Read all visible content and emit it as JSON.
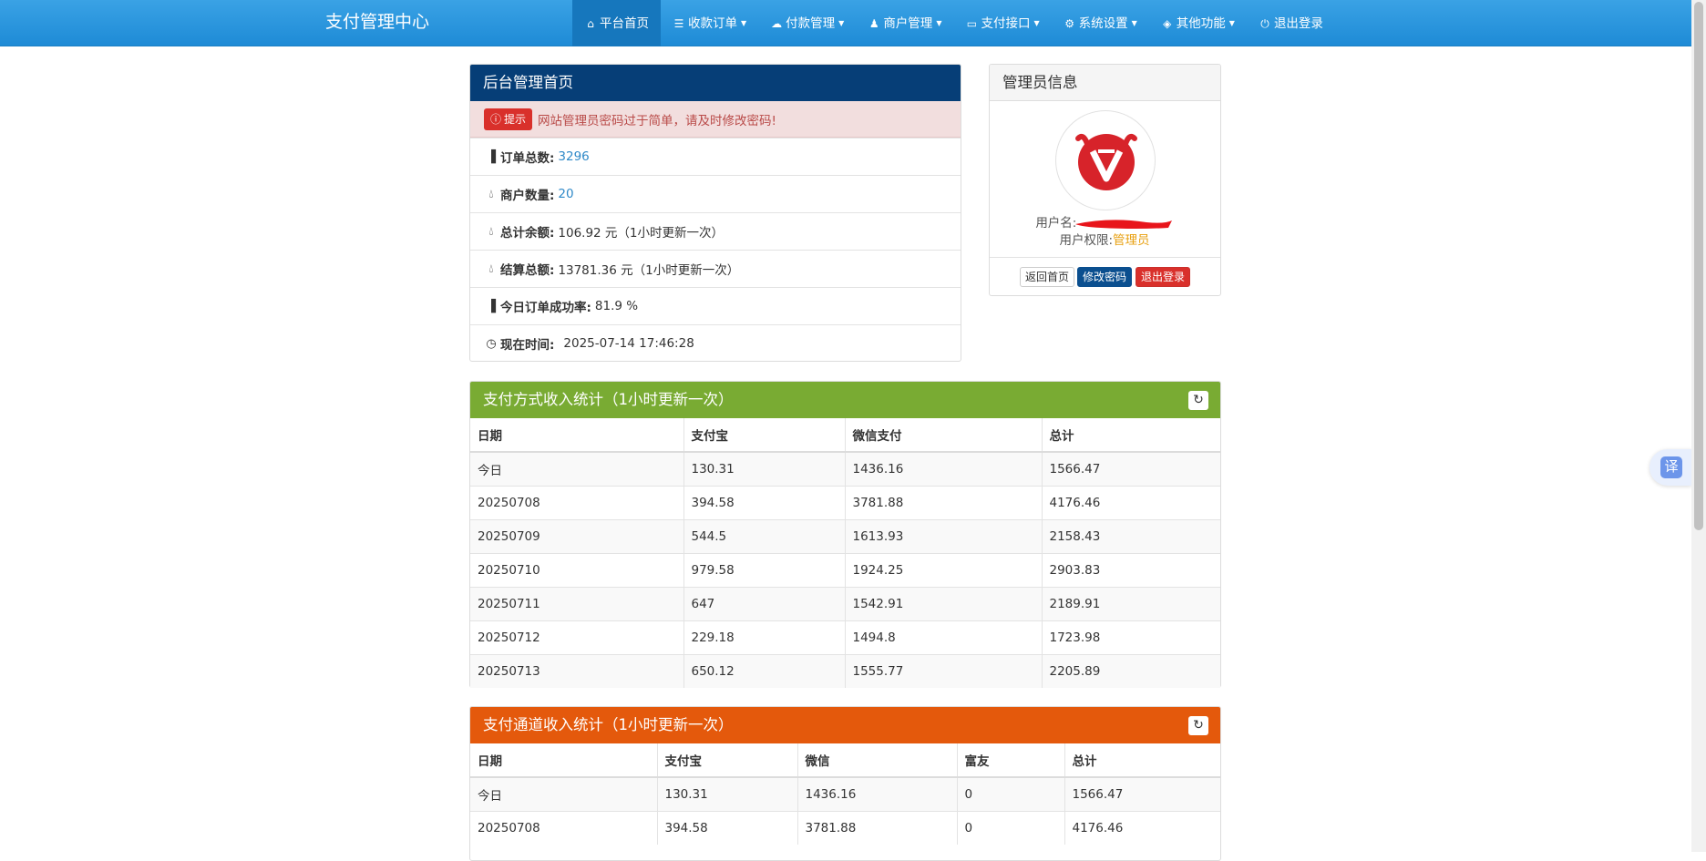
{
  "brand": "支付管理中心",
  "nav": [
    {
      "icon": "home-icon",
      "glyph": "⌂",
      "label": "平台首页",
      "caret": false,
      "active": true
    },
    {
      "icon": "list-icon",
      "glyph": "☰",
      "label": "收款订单",
      "caret": true
    },
    {
      "icon": "cloud-icon",
      "glyph": "☁",
      "label": "付款管理",
      "caret": true
    },
    {
      "icon": "user-icon",
      "glyph": "♟",
      "label": "商户管理",
      "caret": true
    },
    {
      "icon": "card-icon",
      "glyph": "▭",
      "label": "支付接口",
      "caret": true
    },
    {
      "icon": "gear-icon",
      "glyph": "⚙",
      "label": "系统设置",
      "caret": true
    },
    {
      "icon": "cube-icon",
      "glyph": "◈",
      "label": "其他功能",
      "caret": true
    },
    {
      "icon": "power-icon",
      "glyph": "⏻",
      "label": "退出登录",
      "caret": false
    }
  ],
  "home_panel": {
    "title": "后台管理首页",
    "alert_badge": "提示",
    "alert_text": "网站管理员密码过于简单，请及时修改密码!",
    "order_total_label": "订单总数:",
    "order_total": "3296",
    "merchant_count_label": "商户数量:",
    "merchant_count": "20",
    "balance_label": "总计余额:",
    "balance_value": "106.92 元（1小时更新一次）",
    "settle_label": "结算总额:",
    "settle_value": "13781.36 元（1小时更新一次）",
    "success_rate_label": "今日订单成功率:",
    "success_rate": "81.9 %",
    "time_label": "现在时间:",
    "time_value": "2025-07-14 17:46:28"
  },
  "admin_panel": {
    "title": "管理员信息",
    "username_label": "用户名:",
    "role_label": "用户权限:",
    "role_value": "管理员",
    "btn_home": "返回首页",
    "btn_change_pwd": "修改密码",
    "btn_logout": "退出登录",
    "colors": {
      "logo_red": "#d7232a",
      "role": "#e8a010"
    }
  },
  "method_stats": {
    "title": "支付方式收入统计（1小时更新一次）",
    "headers": [
      "日期",
      "支付宝",
      "微信支付",
      "总计"
    ],
    "rows": [
      [
        "今日",
        "130.31",
        "1436.16",
        "1566.47"
      ],
      [
        "20250708",
        "394.58",
        "3781.88",
        "4176.46"
      ],
      [
        "20250709",
        "544.5",
        "1613.93",
        "2158.43"
      ],
      [
        "20250710",
        "979.58",
        "1924.25",
        "2903.83"
      ],
      [
        "20250711",
        "647",
        "1542.91",
        "2189.91"
      ],
      [
        "20250712",
        "229.18",
        "1494.8",
        "1723.98"
      ],
      [
        "20250713",
        "650.12",
        "1555.77",
        "2205.89"
      ]
    ]
  },
  "channel_stats": {
    "title": "支付通道收入统计（1小时更新一次）",
    "headers": [
      "日期",
      "支付宝",
      "微信",
      "富友",
      "总计"
    ],
    "rows": [
      [
        "今日",
        "130.31",
        "1436.16",
        "0",
        "1566.47"
      ],
      [
        "20250708",
        "394.58",
        "3781.88",
        "0",
        "4176.46"
      ]
    ]
  },
  "translate_button": "译"
}
